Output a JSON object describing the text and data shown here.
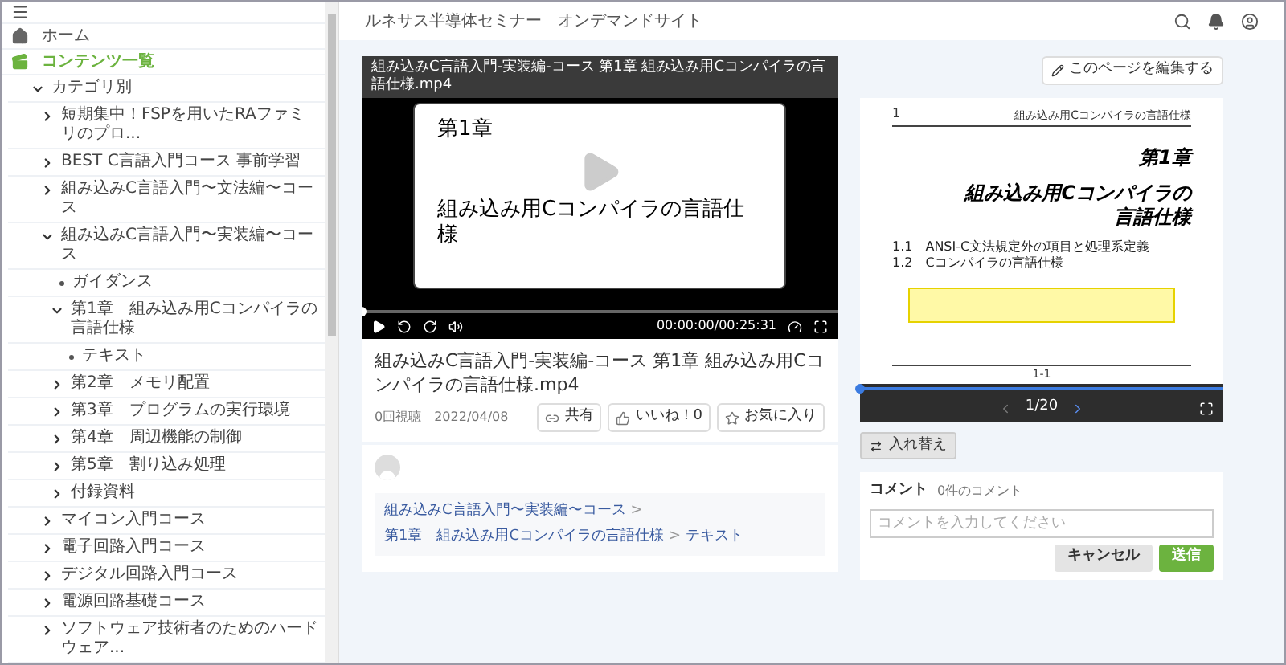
{
  "sidebar": {
    "nav": [
      {
        "kind": "home",
        "label": "ホーム",
        "selected": false
      },
      {
        "kind": "contents",
        "label": "コンテンツ一覧",
        "selected": true
      }
    ],
    "tree": [
      {
        "label": "カテゴリ別",
        "expanded": true,
        "children": [
          {
            "label": "短期集中！FSPを用いたRAファミリのプロ...",
            "expanded": false
          },
          {
            "label": "BEST C言語入門コース 事前学習",
            "expanded": false
          },
          {
            "label": "組み込みC言語入門〜文法編〜コース",
            "expanded": false
          },
          {
            "label": "組み込みC言語入門〜実装編〜コース",
            "expanded": true,
            "children": [
              {
                "label": "ガイダンス",
                "kind": "leaf"
              },
              {
                "label": "第1章　組み込み用Cコンパイラの言語仕様",
                "expanded": true,
                "children": [
                  {
                    "label": "テキスト",
                    "kind": "leaf"
                  }
                ]
              },
              {
                "label": "第2章　メモリ配置",
                "expanded": false
              },
              {
                "label": "第3章　プログラムの実行環境",
                "expanded": false
              },
              {
                "label": "第4章　周辺機能の制御",
                "expanded": false
              },
              {
                "label": "第5章　割り込み処理",
                "expanded": false
              },
              {
                "label": "付録資料",
                "expanded": false
              }
            ]
          },
          {
            "label": "マイコン入門コース",
            "expanded": false
          },
          {
            "label": "電子回路入門コース",
            "expanded": false
          },
          {
            "label": "デジタル回路入門コース",
            "expanded": false
          },
          {
            "label": "電源回路基礎コース",
            "expanded": false
          },
          {
            "label": "ソフトウェア技術者のためのハードウェア...",
            "expanded": false
          }
        ]
      }
    ]
  },
  "header": {
    "title": "ルネサス半導体セミナー　オンデマンドサイト"
  },
  "video": {
    "overlay_title": "組み込みC言語入門-実装編-コース 第1章 組み込み用Cコンパイラの言語仕様.mp4",
    "slide_heading": "第1章",
    "slide_title": "組み込み用Cコンパイラの言語仕様",
    "time": "00:00:00/00:25:31",
    "level": 0
  },
  "details": {
    "title": "組み込みC言語入門-実装編-コース 第1章 組み込み用Cコンパイラの言語仕様.mp4",
    "views": "0回視聴",
    "date": "2022/04/08",
    "actions": [
      {
        "kind": "share",
        "label": "共有"
      },
      {
        "kind": "like",
        "label": "いいね！0"
      },
      {
        "kind": "favorite",
        "label": "お気に入り"
      }
    ]
  },
  "breadcrumb": {
    "separator": ">",
    "items": [
      "組み込みC言語入門〜実装編〜コース",
      "第1章　組み込み用Cコンパイラの言語仕様",
      "テキスト"
    ]
  },
  "edit_button": "このページを編集する",
  "document": {
    "page_number": "1",
    "running_header": "組み込み用Cコンパイラの言語仕様",
    "chapter": "第1章",
    "title_lines": [
      "組み込み用Cコンパイラの",
      "言語仕様"
    ],
    "sections": [
      "1.1　ANSI-C文法規定外の項目と処理系定義",
      "1.2　Cコンパイラの言語仕様"
    ],
    "footer": "1-1"
  },
  "viewer": {
    "level": 0,
    "page": "1/20"
  },
  "swap_button": "入れ替え",
  "comments": {
    "label": "コメント",
    "count": "0件のコメント",
    "placeholder": "コメントを入力してください",
    "buttons": [
      {
        "kind": "cancel",
        "label": "キャンセル"
      },
      {
        "kind": "submit",
        "label": "送信"
      }
    ]
  }
}
